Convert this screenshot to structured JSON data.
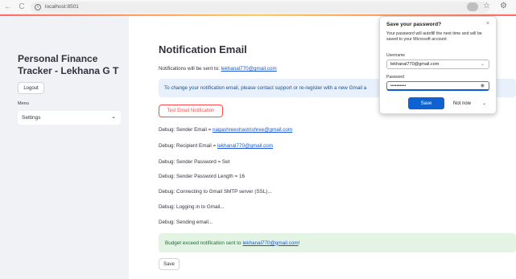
{
  "browser": {
    "url": "localhost:8501",
    "back_icon": "←",
    "reload_icon": "C",
    "info_icon": "i",
    "star_icon": "☆",
    "extensions_icon": "⚙"
  },
  "sidebar": {
    "app_title": "Personal Finance Tracker - Lekhana G T",
    "logout_label": "Logout",
    "menu_label": "Menu",
    "menu_value": "Settings",
    "chevron": "⌄"
  },
  "main": {
    "title": "Notification Email",
    "sent_to_prefix": "Notifications will be sent to: ",
    "sent_to_email": "lekhanal770@gmail.com",
    "info_text": "To change your notification email, please contact support or re-register with a new Gmail a",
    "test_button": "Test Email Notification",
    "debug": {
      "sender_prefix": "Debug: Sender Email = ",
      "sender_email": "nagashreeshastrishree@gmail.com",
      "recipient_prefix": "Debug: Recipient Email = ",
      "recipient_email": "lekhanal770@gmail.com",
      "sender_password": "Debug: Sender Password = Set",
      "password_length": "Debug: Sender Password Length = 16",
      "connecting": "Debug: Connecting to Gmail SMTP server (SSL)...",
      "logging_in": "Debug: Logging in to Gmail...",
      "sending": "Debug: Sending email..."
    },
    "success_prefix": "Budget exceed notification sent to ",
    "success_email": "lekhanal770@gmail.com",
    "success_suffix": "!",
    "save_button": "Save"
  },
  "popup": {
    "title": "Save your password?",
    "close_icon": "×",
    "description": "Your password will autofill the next time and will be saved to your Microsoft account",
    "username_label": "Username",
    "username_value": "lekhanal770@gmail.com",
    "password_label": "Password",
    "password_value": "••••••••••",
    "save_label": "Save",
    "not_now_label": "Not now",
    "more_icon": "⌄",
    "eye_icon": "◉"
  },
  "colors": {
    "accent_red": "#ff4b4b",
    "link_blue": "#1a56d6",
    "save_blue": "#0f62d1"
  }
}
